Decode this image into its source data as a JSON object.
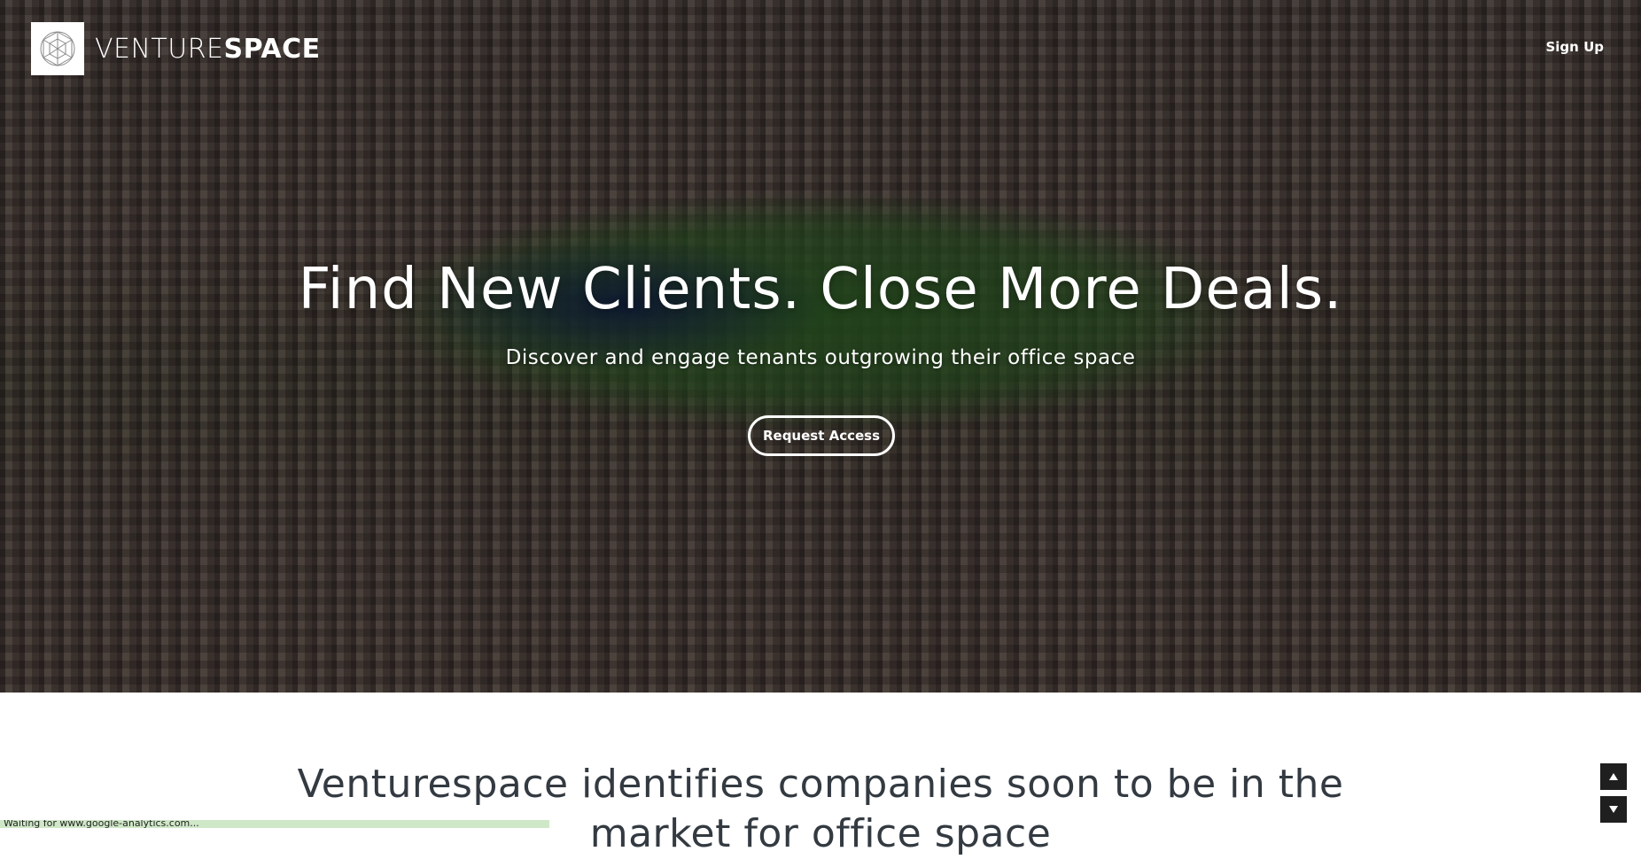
{
  "header": {
    "logo_text_light": "VENTURE",
    "logo_text_bold": "SPACE",
    "signup_label": "Sign Up"
  },
  "hero": {
    "title": "Find New Clients. Close More Deals.",
    "subtitle": "Discover and engage tenants outgrowing their office space",
    "cta_label": "Request Access"
  },
  "section": {
    "title_line1": "Venturespace identifies companies soon to be in the",
    "title_line2": "market for office space"
  },
  "status": {
    "text": "Waiting for www.google-analytics.com..."
  },
  "controls": {
    "scroll_up_icon": "triangle-up-icon",
    "scroll_down_icon": "triangle-down-icon"
  },
  "colors": {
    "text_dark": "#333a41",
    "white": "#ffffff",
    "scroll_button": "#1f1f1f",
    "status_bar": "#cfe8c7"
  }
}
